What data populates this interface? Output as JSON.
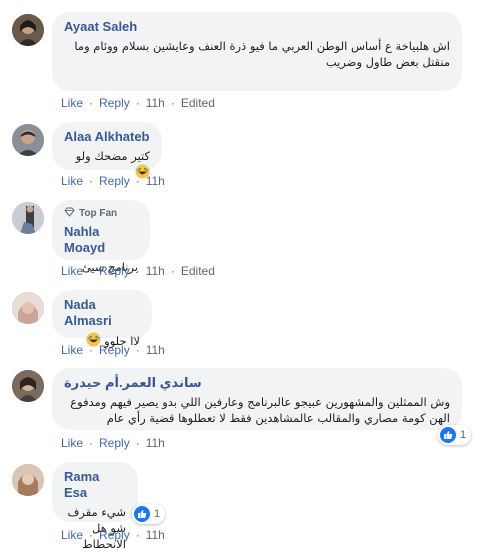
{
  "actions": {
    "like": "Like",
    "reply": "Reply",
    "dot": "·"
  },
  "comments": [
    {
      "author": "Ayaat Saleh",
      "text": "اش هلبياخة ع أساس الوطن العربي ما فيو ذرة العنف وعايشين بسلام ووئام وما منقتل بعض طاول وضريب",
      "time": "11h",
      "edited": "Edited"
    },
    {
      "author": "Alaa Alkhateb",
      "text": "كتير مضحك ولو",
      "emoji": "laughing-emoji",
      "time": "11h"
    },
    {
      "badge": "Top Fan",
      "badge_icon": "diamond-icon",
      "author": "Nahla Moayd",
      "text": "برنامج سيئ",
      "time": "11h",
      "edited": "Edited"
    },
    {
      "author": "Nada Almasri",
      "text": "لاا حلوو",
      "emoji": "laughing-emoji",
      "time": "11h"
    },
    {
      "author": "ساندي العمر.أم حيدرة",
      "text": "وش الممثلين والمشهورين عبيجو عالبرنامج وعارفين اللي بدو يصير فيهم ومدفوع الهن كومة مصاري والمقالب عالمشاهدين فقط لا تعطلوها قضية رأي عام",
      "time": "11h",
      "reaction_count": "1"
    },
    {
      "author": "Rama Esa",
      "text_line1": "شيء مقرف",
      "text_line2": "شو هل الانحطاط",
      "time": "11h",
      "reaction_count": "1"
    }
  ],
  "colors": {
    "link": "#385898",
    "action": "#4267b2",
    "bubble": "#f2f3f5",
    "like": "#1877f2"
  }
}
